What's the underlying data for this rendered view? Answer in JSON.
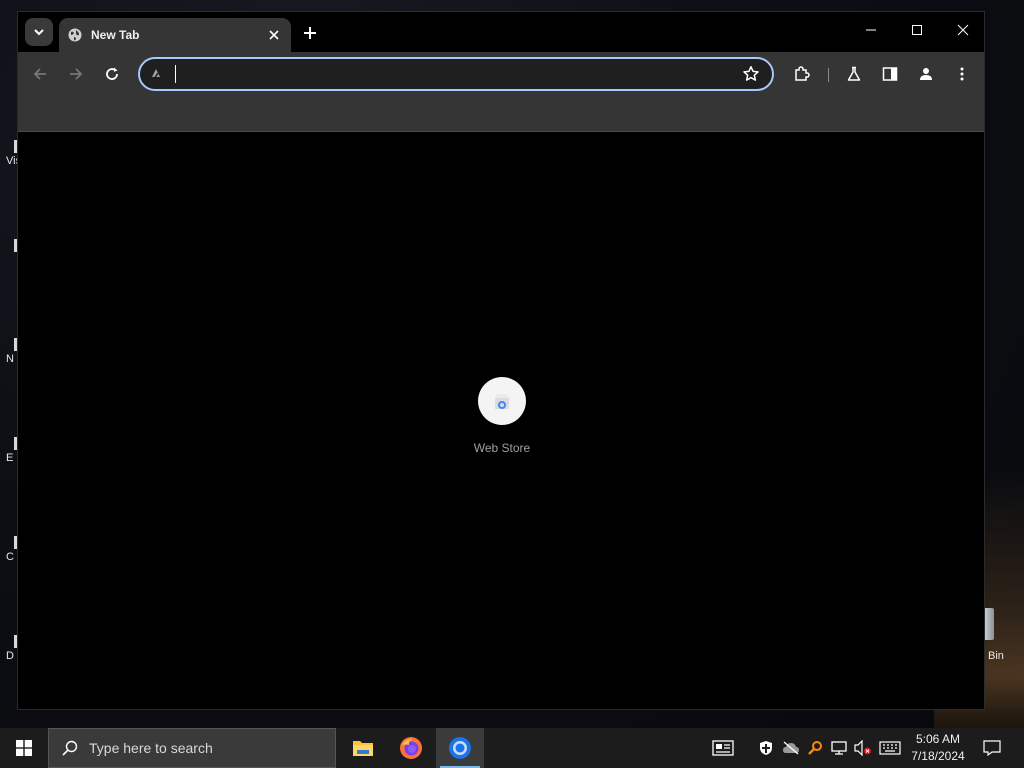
{
  "desktop": {
    "icons": [
      {
        "label": "Vis",
        "top": 0
      },
      {
        "label": "",
        "top": 0
      },
      {
        "label": "N",
        "top": 0
      },
      {
        "label": "E",
        "top": 0
      },
      {
        "label": "C",
        "top": 0
      },
      {
        "label": "D",
        "top": 0
      }
    ],
    "recycle_bin_label": "Bin"
  },
  "browser": {
    "tab": {
      "title": "New Tab"
    },
    "omnibox": {
      "value": "",
      "placeholder": ""
    },
    "new_tab_page": {
      "shortcuts": [
        {
          "label": "Web Store",
          "icon": "web-store-icon"
        }
      ]
    },
    "colors": {
      "omnibox_border": "#a8c7fa",
      "toolbar": "#353535",
      "frame": "#000000"
    }
  },
  "taskbar": {
    "search_placeholder": "Type here to search",
    "apps": [
      {
        "name": "File Explorer",
        "icon": "file-explorer-icon"
      },
      {
        "name": "Firefox",
        "icon": "firefox-icon"
      },
      {
        "name": "Chrome",
        "icon": "chrome-icon",
        "active": true
      }
    ],
    "clock": {
      "time": "5:06 AM",
      "date": "7/18/2024"
    }
  }
}
